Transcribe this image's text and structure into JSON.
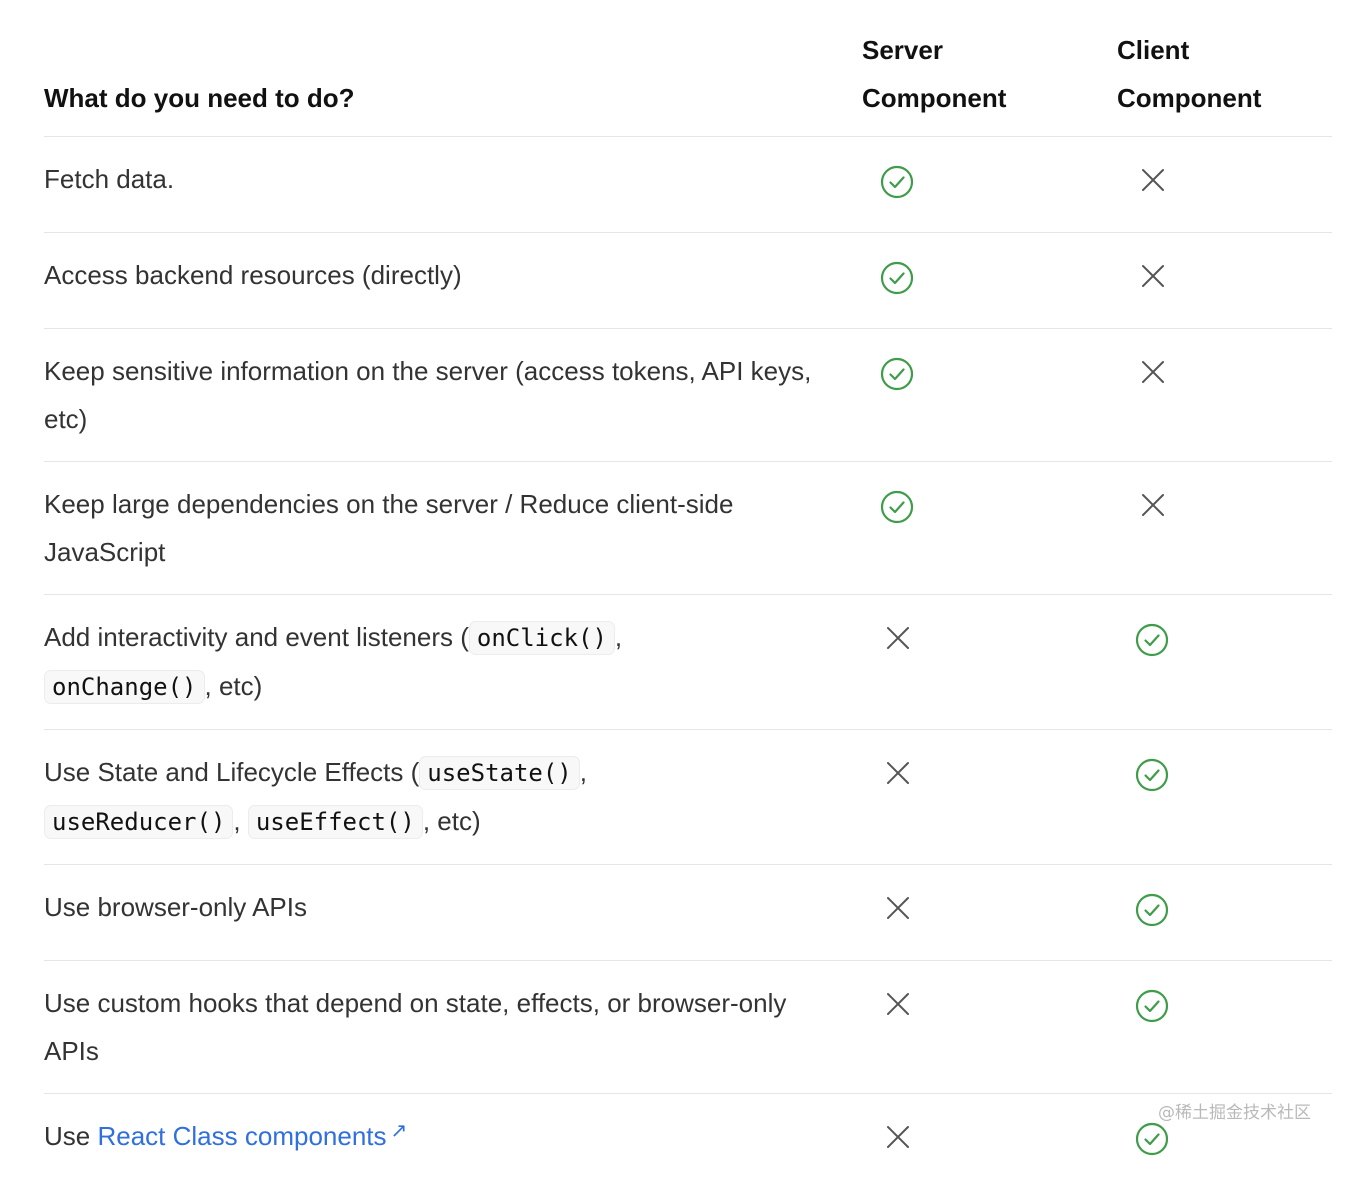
{
  "header": {
    "question": "What do you need to do?",
    "server_line1": "Server",
    "server_line2": "Component",
    "client_line1": "Client",
    "client_line2": "Component"
  },
  "rows": [
    {
      "text": "Fetch data.",
      "server": "check",
      "client": "cross"
    },
    {
      "text": "Access backend resources (directly)",
      "server": "check",
      "client": "cross"
    },
    {
      "text": "Keep sensitive information on the server (access tokens, API keys, etc)",
      "server": "check",
      "client": "cross"
    },
    {
      "text": "Keep large dependencies on the server / Reduce client-side JavaScript",
      "server": "check",
      "client": "cross"
    },
    {
      "p1": "Add interactivity and event listeners (",
      "c1": "onClick()",
      "p2": ",",
      "c2": "onChange()",
      "p3": ", etc)",
      "server": "cross",
      "client": "check"
    },
    {
      "p1": "Use State and Lifecycle Effects (",
      "c1": "useState()",
      "p2": ",",
      "c2": "useReducer()",
      "p3": ",",
      "c3": "useEffect()",
      "p4": ", etc)",
      "server": "cross",
      "client": "check"
    },
    {
      "text": "Use browser-only APIs",
      "server": "cross",
      "client": "check"
    },
    {
      "text": "Use custom hooks that depend on state, effects, or browser-only APIs",
      "server": "cross",
      "client": "check"
    },
    {
      "prefix": "Use",
      "link": "React Class components",
      "link_icon": "↗",
      "server": "cross",
      "client": "check"
    }
  ],
  "icons": {
    "check": "check-circle-icon",
    "cross": "x-icon"
  },
  "colors": {
    "check": "#3f9c4a",
    "cross": "#555555",
    "link": "#2f6fde"
  },
  "watermark": "@稀土掘金技术社区"
}
